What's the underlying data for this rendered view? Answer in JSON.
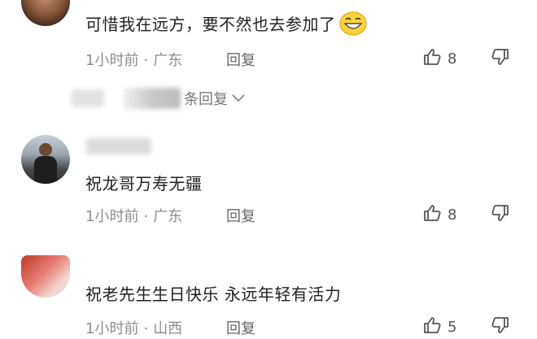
{
  "comments": [
    {
      "text": "可惜我在远方，要不然也去参加了",
      "emoji": "grinning-face-emoji",
      "time": "1小时前",
      "location": "广东",
      "reply_label": "回复",
      "likes": "8"
    },
    {
      "text": "祝龙哥万寿无疆",
      "time": "1小时前",
      "location": "广东",
      "reply_label": "回复",
      "likes": "8"
    },
    {
      "text": "祝老先生生日快乐 永远年轻有活力",
      "time": "1小时前",
      "location": "山西",
      "reply_label": "回复",
      "likes": "5"
    }
  ],
  "more_replies_label": "条回复",
  "icons": {
    "like": "thumbs-up-icon",
    "dislike": "thumbs-down-icon",
    "expand": "chevron-down-icon"
  },
  "colors": {
    "text": "#1f1f1f",
    "meta": "#8c8c8c",
    "icon": "#555555"
  }
}
